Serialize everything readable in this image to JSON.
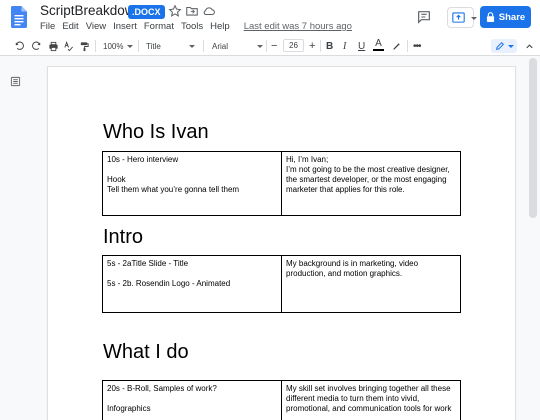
{
  "header": {
    "title": "ScriptBreakdown",
    "badge": ".DOCX",
    "menu": [
      "File",
      "Edit",
      "View",
      "Insert",
      "Format",
      "Tools",
      "Help"
    ],
    "last_edit": "Last edit was 7 hours ago",
    "share_label": "Share"
  },
  "toolbar": {
    "zoom": "100%",
    "style": "Title",
    "font": "Arial",
    "font_size": "26"
  },
  "colors": {
    "accent": "#1a73e8",
    "doc_icon": "#4285f4"
  },
  "doc": {
    "sections": [
      {
        "heading": "Who Is Ivan",
        "left": [
          "10s - Hero interview",
          "",
          "Hook",
          "Tell them what you’re gonna tell them"
        ],
        "right": [
          "Hi, I’m Ivan;",
          "I’m not going to be the most creative designer, the smartest developer, or the most engaging marketer that applies for this role."
        ]
      },
      {
        "heading": "Intro",
        "left": [
          "5s - 2aTitle Slide - Title",
          "",
          "5s - 2b. Rosendin Logo - Animated"
        ],
        "right": [
          "My background is in marketing, video production, and motion graphics."
        ]
      },
      {
        "heading": "What I do",
        "left": [
          "20s - B-Roll, Samples of work?",
          "",
          "Infographics"
        ],
        "right": [
          "My skill set involves bringing together all these different media to turn them into vivid, promotional, and communication tools for work"
        ]
      }
    ]
  }
}
